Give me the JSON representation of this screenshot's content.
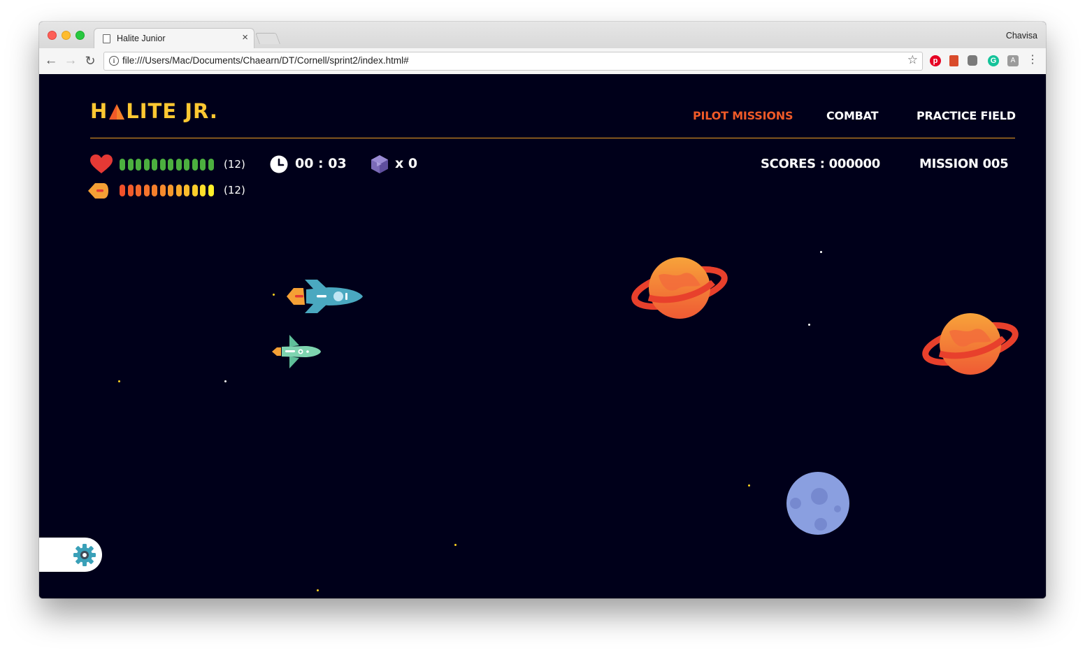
{
  "browser": {
    "tab_title": "Halite Junior",
    "tab_close": "×",
    "profile_name": "Chavisa",
    "url": "file:///Users/Mac/Documents/Chaearn/DT/Cornell/sprint2/index.html#",
    "back_icon": "←",
    "forward_icon": "→",
    "reload_icon": "↻",
    "star_icon": "☆",
    "menu_icon": "⋮"
  },
  "game": {
    "logo_left": "H",
    "logo_right": "LITE JR.",
    "nav": [
      {
        "label": "PILOT MISSIONS",
        "active": true
      },
      {
        "label": "COMBAT",
        "active": false
      },
      {
        "label": "PRACTICE FIELD",
        "active": false
      }
    ],
    "health": {
      "value": 12,
      "max": 12,
      "label": "(12)",
      "color": "#4caf3f"
    },
    "fuel": {
      "value": 12,
      "max": 12,
      "label": "(12)"
    },
    "timer": "00 : 03",
    "gems": "x 0",
    "scores": "SCORES : 000000",
    "mission": "MISSION 005"
  },
  "colors": {
    "accent": "#f05a28",
    "logo": "#ffc832",
    "background": "#00001a",
    "divider": "#f0a020"
  },
  "icons": [
    "heart-icon",
    "fuel-icon",
    "clock-icon",
    "gem-icon",
    "gear-icon",
    "rocket-icon",
    "shuttle-icon",
    "ringed-planet-icon",
    "moon-icon"
  ]
}
